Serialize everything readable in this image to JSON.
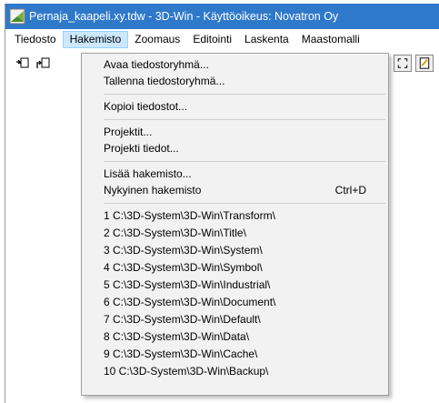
{
  "window": {
    "title": "Pernaja_kaapeli.xy.tdw - 3D-Win - Käyttöoikeus: Novatron Oy",
    "icon": "3d-win-app-icon"
  },
  "menubar": {
    "items": [
      {
        "label": "Tiedosto"
      },
      {
        "label": "Hakemisto"
      },
      {
        "label": "Zoomaus"
      },
      {
        "label": "Editointi"
      },
      {
        "label": "Laskenta"
      },
      {
        "label": "Maastomalli"
      }
    ],
    "active": "Hakemisto"
  },
  "toolbar": {
    "buttons": [
      "open-folder-icon",
      "save-folder-icon",
      "zoom-extents-icon",
      "drawing-icon"
    ]
  },
  "dropdown": {
    "open_group": "Avaa tiedostoryhmä...",
    "save_group": "Tallenna tiedostoryhmä...",
    "copy_files": "Kopioi tiedostot...",
    "projects": "Projektit...",
    "project_info": "Projekti tiedot...",
    "add_directory": "Lisää hakemisto...",
    "current_directory": "Nykyinen hakemisto",
    "current_directory_shortcut": "Ctrl+D",
    "recent": [
      "1 C:\\3D-System\\3D-Win\\Transform\\",
      "2 C:\\3D-System\\3D-Win\\Title\\",
      "3 C:\\3D-System\\3D-Win\\System\\",
      "4 C:\\3D-System\\3D-Win\\Symbol\\",
      "5 C:\\3D-System\\3D-Win\\Industrial\\",
      "6 C:\\3D-System\\3D-Win\\Document\\",
      "7 C:\\3D-System\\3D-Win\\Default\\",
      "8 C:\\3D-System\\3D-Win\\Data\\",
      "9 C:\\3D-System\\3D-Win\\Cache\\",
      "10 C:\\3D-System\\3D-Win\\Backup\\"
    ]
  }
}
